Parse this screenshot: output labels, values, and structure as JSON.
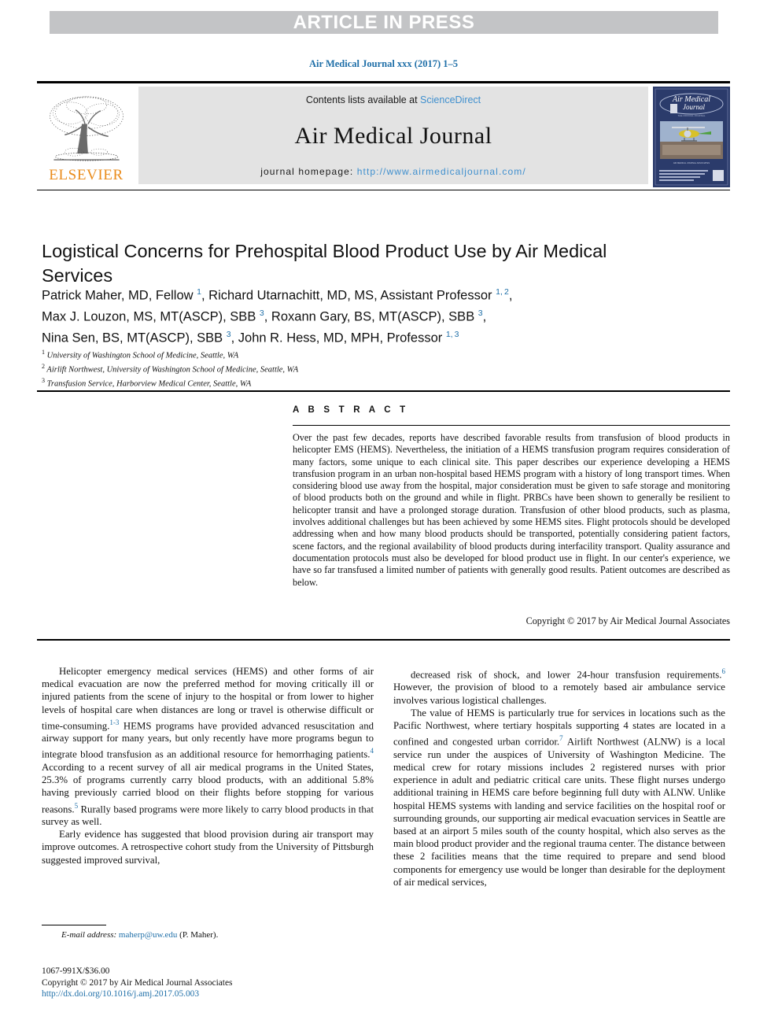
{
  "banner": {
    "article_in_press": "ARTICLE IN PRESS"
  },
  "running_head": "Air Medical Journal xxx (2017) 1–5",
  "masthead": {
    "contents_prefix": "Contents lists available at ",
    "contents_link": "ScienceDirect",
    "journal_title": "Air Medical Journal",
    "homepage_label": "journal homepage: ",
    "homepage_url": "http://www.airmedicaljournal.com/",
    "publisher": "ELSEVIER",
    "cover_title_line1": "Air Medical",
    "cover_title_line2": "Journal"
  },
  "article": {
    "title": "Logistical Concerns for Prehospital Blood Product Use by Air Medical Services",
    "authors_html": "Patrick Maher, MD, Fellow <sup>1</sup>, Richard Utarnachitt, MD, MS, Assistant Professor <sup>1, 2</sup>,<br>Max J. Louzon, MS, MT(ASCP), SBB <sup>3</sup>, Roxann Gary, BS, MT(ASCP), SBB <sup>3</sup>,<br>Nina Sen, BS, MT(ASCP), SBB <sup>3</sup>, John R. Hess, MD, MPH, Professor <sup>1, 3</sup>",
    "affiliations": [
      {
        "marker": "1",
        "text": "University of Washington School of Medicine, Seattle, WA"
      },
      {
        "marker": "2",
        "text": "Airlift Northwest, University of Washington School of Medicine, Seattle, WA"
      },
      {
        "marker": "3",
        "text": "Transfusion Service, Harborview Medical Center, Seattle, WA"
      }
    ]
  },
  "abstract": {
    "heading": "A B S T R A C T",
    "text": "Over the past few decades, reports have described favorable results from transfusion of blood products in helicopter EMS (HEMS). Nevertheless, the initiation of a HEMS transfusion program requires consideration of many factors, some unique to each clinical site. This paper describes our experience developing a HEMS transfusion program in an urban non-hospital based HEMS program with a history of long transport times. When considering blood use away from the hospital, major consideration must be given to safe storage and monitoring of blood products both on the ground and while in flight. PRBCs have been shown to generally be resilient to helicopter transit and have a prolonged storage duration. Transfusion of other blood products, such as plasma, involves additional challenges but has been achieved by some HEMS sites. Flight protocols should be developed addressing when and how many blood products should be transported, potentially considering patient factors, scene factors, and the regional availability of blood products during interfacility transport. Quality assurance and documentation protocols must also be developed for blood product use in flight. In our center's experience, we have so far transfused a limited number of patients with generally good results. Patient outcomes are described as below.",
    "copyright": "Copyright © 2017 by Air Medical Journal Associates"
  },
  "body": {
    "left_column": [
      "Helicopter emergency medical services (HEMS) and other forms of air medical evacuation are now the preferred method for moving critically ill or injured patients from the scene of injury to the hospital or from lower to higher levels of hospital care when distances are long or travel is otherwise difficult or time-consuming.<sup>1-3</sup> HEMS programs have provided advanced resuscitation and airway support for many years, but only recently have more programs begun to integrate blood transfusion as an additional resource for hemorrhaging patients.<sup>4</sup> According to a recent survey of all air medical programs in the United States, 25.3% of programs currently carry blood products, with an additional 5.8% having previously carried blood on their flights before stopping for various reasons.<sup>5</sup> Rurally based programs were more likely to carry blood products in that survey as well.",
      "Early evidence has suggested that blood provision during air transport may improve outcomes. A retrospective cohort study from the University of Pittsburgh suggested improved survival,"
    ],
    "right_column": [
      "decreased risk of shock, and lower 24-hour transfusion requirements.<sup>6</sup> However, the provision of blood to a remotely based air ambulance service involves various logistical challenges.",
      "The value of HEMS is particularly true for services in locations such as the Pacific Northwest, where tertiary hospitals supporting 4 states are located in a confined and congested urban corridor.<sup>7</sup> Airlift Northwest (ALNW) is a local service run under the auspices of University of Washington Medicine. The medical crew for rotary missions includes 2 registered nurses with prior experience in adult and pediatric critical care units. These flight nurses undergo additional training in HEMS care before beginning full duty with ALNW. Unlike hospital HEMS systems with landing and service facilities on the hospital roof or surrounding grounds, our supporting air medical evacuation services in Seattle are based at an airport 5 miles south of the county hospital, which also serves as the main blood product provider and the regional trauma center. The distance between these 2 facilities means that the time required to prepare and send blood components for emergency use would be longer than desirable for the deployment of air medical services,"
    ]
  },
  "footnote": {
    "label": "E-mail address:",
    "email": "maherp@uw.edu",
    "suffix": " (P. Maher)."
  },
  "footer": {
    "issn": "1067-991X/$36.00",
    "copyright": "Copyright © 2017 by Air Medical Journal Associates",
    "doi": "http://dx.doi.org/10.1016/j.amj.2017.05.003"
  },
  "colors": {
    "link_blue": "#1f6fa8",
    "sciencedirect_blue": "#3f8fce",
    "elsevier_orange": "#ea8c1c",
    "banner_gray": "#c3c4c6",
    "masthead_gray": "#e3e3e3"
  }
}
